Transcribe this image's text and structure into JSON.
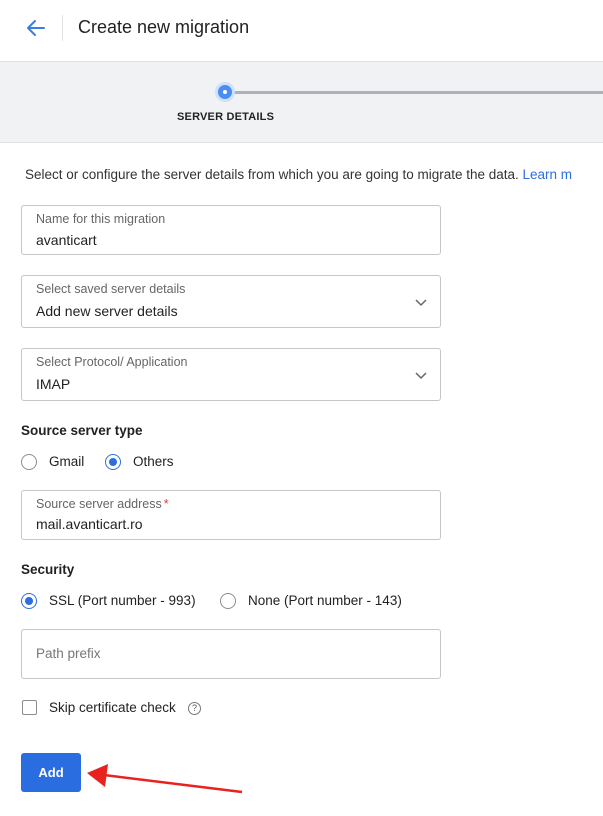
{
  "header": {
    "title": "Create new migration"
  },
  "stepper": {
    "steps": [
      {
        "label": "SERVER DETAILS",
        "active": true
      }
    ]
  },
  "intro": {
    "text": "Select or configure the server details from which you are going to migrate the data.",
    "link": "Learn m"
  },
  "form": {
    "migration_name": {
      "label": "Name for this migration",
      "value": "avanticart"
    },
    "saved_server": {
      "label": "Select saved server details",
      "value": "Add new server details"
    },
    "protocol": {
      "label": "Select Protocol/ Application",
      "value": "IMAP"
    },
    "server_type": {
      "label": "Source server type",
      "options": [
        {
          "label": "Gmail",
          "selected": false
        },
        {
          "label": "Others",
          "selected": true
        }
      ]
    },
    "source_address": {
      "label": "Source server address",
      "required_mark": "*",
      "value": "mail.avanticart.ro"
    },
    "security": {
      "label": "Security",
      "options": [
        {
          "label": "SSL (Port number - 993)",
          "selected": true
        },
        {
          "label": "None (Port number - 143)",
          "selected": false
        }
      ]
    },
    "path_prefix": {
      "placeholder": "Path prefix",
      "value": ""
    },
    "skip_cert": {
      "label": "Skip certificate check",
      "checked": false,
      "help_icon": "?"
    }
  },
  "actions": {
    "add_label": "Add"
  },
  "colors": {
    "accent": "#2a6de0",
    "annotation_arrow": "#e8231f"
  }
}
